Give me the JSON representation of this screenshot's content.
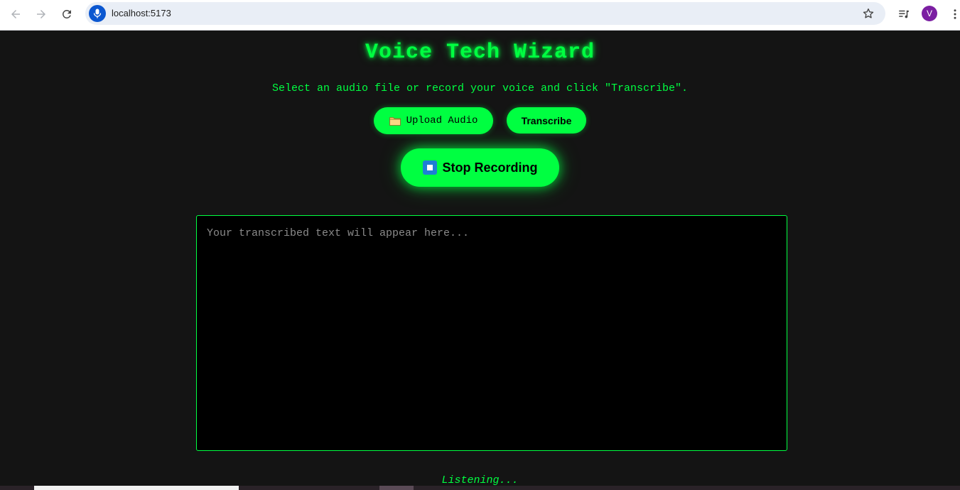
{
  "browser": {
    "url": "localhost:5173",
    "avatar_letter": "V",
    "avatar_color": "#7b1fa2",
    "mic_badge_color": "#0b57d0",
    "icons": [
      "back-arrow-icon",
      "forward-arrow-icon",
      "reload-icon",
      "microphone-icon",
      "star-icon",
      "media-playlist-icon",
      "more-vert-icon"
    ]
  },
  "app": {
    "title": "Voice Tech Wizard",
    "subtitle": "Select an audio file or record your voice and click \"Transcribe\".",
    "upload_label": "Upload Audio",
    "upload_icon": "folder-icon",
    "transcribe_label": "Transcribe",
    "stop_label": "Stop Recording",
    "stop_icon": "stop-square-icon",
    "transcript_value": "",
    "transcript_placeholder": "Your transcribed text will appear here...",
    "status": "Listening..."
  },
  "theme": {
    "background": "#141414",
    "accent": "#00ff41",
    "textarea_bg": "#000000",
    "placeholder_color": "#8a8a8a"
  }
}
